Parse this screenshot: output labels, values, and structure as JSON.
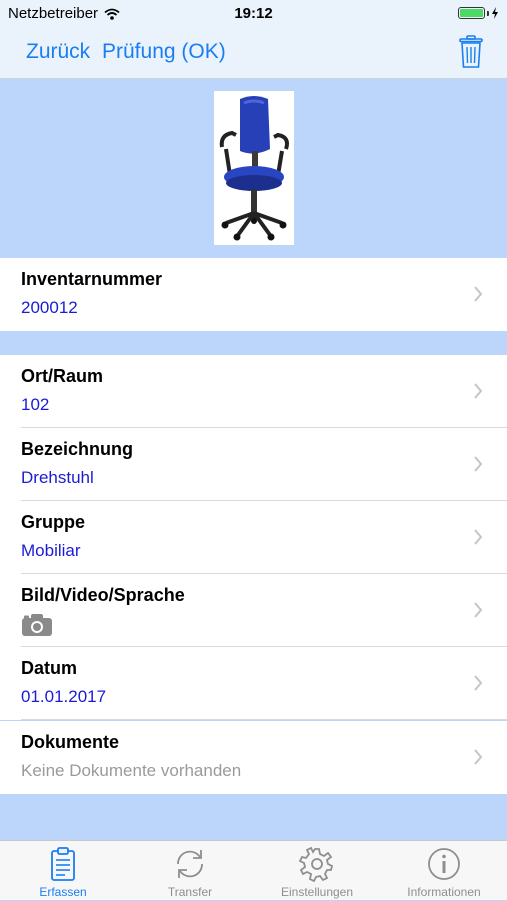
{
  "status_bar": {
    "carrier": "Netzbetreiber",
    "time": "19:12"
  },
  "nav": {
    "back_label": "Zurück",
    "title": "Prüfung (OK)",
    "trash_icon": "trash-icon"
  },
  "fields": [
    {
      "label": "Inventarnummer",
      "value": "200012"
    },
    {
      "label": "Ort/Raum",
      "value": "102"
    },
    {
      "label": "Bezeichnung",
      "value": "Drehstuhl"
    },
    {
      "label": "Gruppe",
      "value": "Mobiliar"
    },
    {
      "label": "Bild/Video/Sprache",
      "value_icon": "camera-icon"
    },
    {
      "label": "Datum",
      "value": "01.01.2017"
    },
    {
      "label": "Dokumente",
      "value": "Keine Dokumente vorhanden"
    }
  ],
  "tabs": [
    {
      "label": "Erfassen",
      "icon": "clipboard-icon",
      "active": true
    },
    {
      "label": "Transfer",
      "icon": "sync-icon",
      "active": false
    },
    {
      "label": "Einstellungen",
      "icon": "gear-icon",
      "active": false
    },
    {
      "label": "Informationen",
      "icon": "info-icon",
      "active": false
    }
  ],
  "colors": {
    "accent": "#1a7ef2",
    "value_text": "#1b1bd6",
    "section_background": "#bcd6fb",
    "chair_blue": "#2740b8"
  }
}
